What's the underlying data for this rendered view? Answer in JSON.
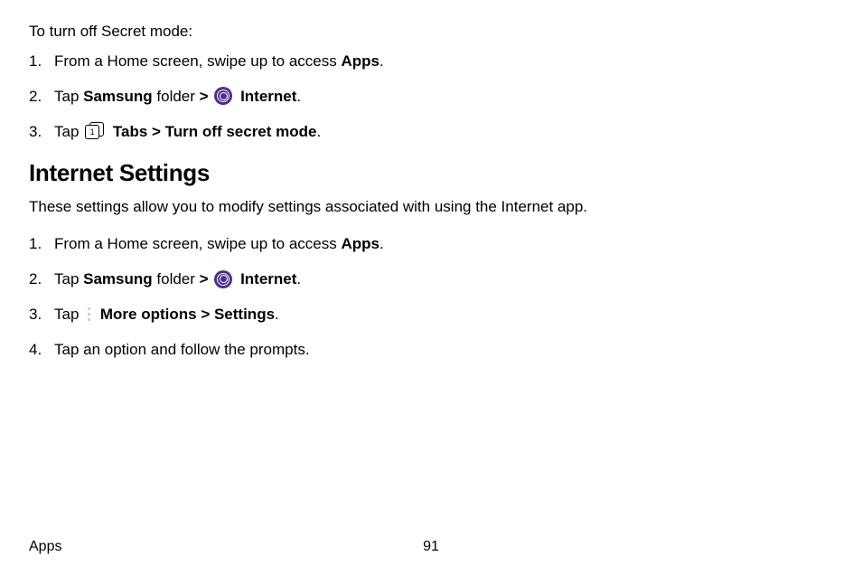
{
  "section1": {
    "intro": "To turn off Secret mode:",
    "steps": [
      {
        "num": "1.",
        "pre": "From a Home screen, swipe up to access ",
        "bold1": "Apps",
        "post": "."
      },
      {
        "num": "2.",
        "pre": "Tap ",
        "bold1": "Samsung",
        "mid1": " folder ",
        "bold2": ">",
        "icon": "internet-icon",
        "bold3": "Internet",
        "post": "."
      },
      {
        "num": "3.",
        "pre": "Tap ",
        "icon": "tabs-icon",
        "tabs_num": "1",
        "bold1": "Tabs",
        "bold_sep": " > ",
        "bold2": "Turn off secret mode",
        "post": "."
      }
    ]
  },
  "section2": {
    "heading": "Internet Settings",
    "desc": "These settings allow you to modify settings associated with using the Internet app.",
    "steps": [
      {
        "num": "1.",
        "pre": "From a Home screen, swipe up to access ",
        "bold1": "Apps",
        "post": "."
      },
      {
        "num": "2.",
        "pre": "Tap ",
        "bold1": "Samsung",
        "mid1": " folder ",
        "bold2": ">",
        "icon": "internet-icon",
        "bold3": "Internet",
        "post": "."
      },
      {
        "num": "3.",
        "pre": "Tap ",
        "icon": "more-icon",
        "bold1": "More options",
        "bold_sep": " > ",
        "bold2": "Settings",
        "post": "."
      },
      {
        "num": "4.",
        "pre": "Tap an option and follow the prompts."
      }
    ]
  },
  "footer": {
    "left": "Apps",
    "page": "91"
  }
}
